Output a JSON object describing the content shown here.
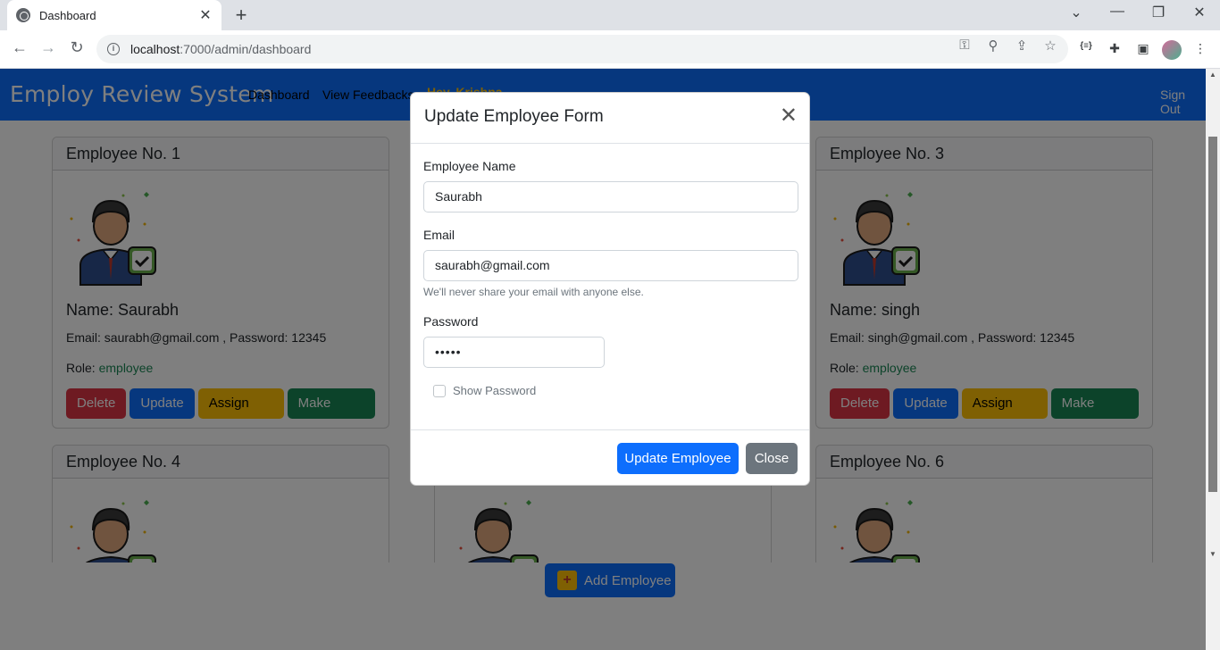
{
  "browser": {
    "tab_title": "Dashboard",
    "new_tab": "+",
    "url_host": "localhost",
    "url_rest": ":7000/admin/dashboard",
    "minimize": "⌄",
    "win_min": "—",
    "win_restore": "❐",
    "win_close": "✕"
  },
  "navbar": {
    "brand": "Employ Review System",
    "links": [
      "Dashboard",
      "View Feedbacks"
    ],
    "user": "Hey, Krishna",
    "sign_out": "Sign Out"
  },
  "cards": [
    {
      "header": "Employee No. 1",
      "name": "Name: Saurabh",
      "info": "Email: saurabh@gmail.com , Password: 12345",
      "role_label": "Role: ",
      "role": "employee",
      "buttons": [
        "Delete",
        "Update",
        "Assign Task",
        "Make Admin"
      ]
    },
    {
      "header": "Employee No. 3",
      "name": "Name: singh",
      "info": "Email: singh@gmail.com , Password: 12345",
      "role_label": "Role: ",
      "role": "employee",
      "buttons": [
        "Delete",
        "Update",
        "Assign Task",
        "Make Admin"
      ]
    },
    {
      "header": "Employee No. 4"
    },
    {
      "header": "Employee No. 6"
    }
  ],
  "add_button": "Add Employee",
  "modal": {
    "title": "Update Employee Form",
    "name_label": "Employee Name",
    "name_value": "Saurabh",
    "email_label": "Email",
    "email_value": "saurabh@gmail.com",
    "email_help": "We'll never share your email with anyone else.",
    "password_label": "Password",
    "password_value": "•••••",
    "show_password": "Show Password",
    "update_button": "Update Employee",
    "close_button": "Close"
  },
  "colors": {
    "primary": "#0d6efd",
    "danger": "#dc3545",
    "warning": "#ffc107",
    "success": "#198754",
    "secondary": "#6c757d"
  }
}
